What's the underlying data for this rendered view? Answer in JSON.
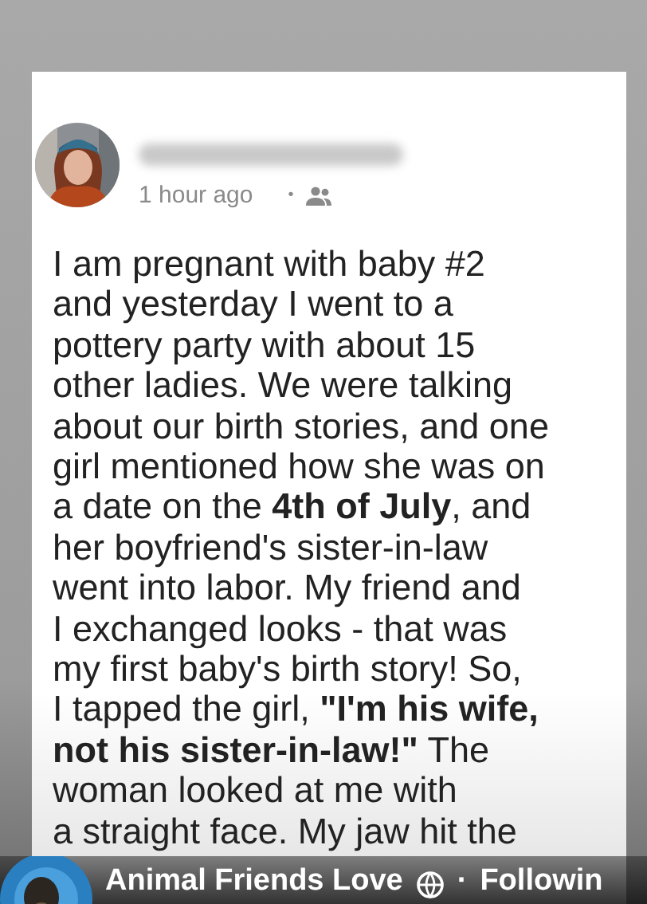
{
  "post": {
    "time": "1 hour ago",
    "separator": "•",
    "lines": [
      "I am pregnant with baby #2",
      "and yesterday I went to a",
      "pottery party with about 15",
      "other ladies. We were talking",
      "about our birth stories, and one",
      "girl mentioned how she was on",
      "a date on the **4th of July**, and",
      "her boyfriend's sister-in-law",
      "went into labor. My friend and",
      "I exchanged looks - that was",
      "my first baby's birth story! So,",
      "I tapped the girl, **\"I'm his wife,**",
      "**not his sister-in-law!\"** The",
      "woman looked at me with",
      "a straight face. My jaw hit the"
    ]
  },
  "overlay": {
    "account": "Animal Friends Love",
    "separator": "·",
    "follow": "Followin"
  }
}
